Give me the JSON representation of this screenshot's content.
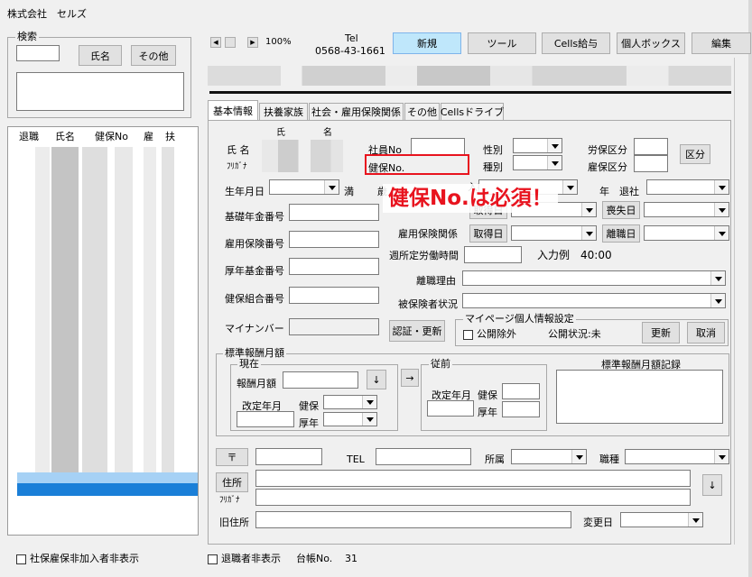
{
  "window": {
    "title": "株式会社　セルズ"
  },
  "search": {
    "group_title": "検索",
    "name_button": "氏名",
    "other_button": "その他",
    "columns": [
      "退職",
      "氏名",
      "健保No",
      "雇",
      "扶"
    ]
  },
  "footer_left": {
    "checkbox_label": "社保雇保非加入者非表示"
  },
  "nav": {
    "zoom": "100%",
    "tel_label": "Tel",
    "tel_number": "0568-43-1661"
  },
  "toolbar": {
    "new": "新規",
    "tool": "ツール",
    "cells_pay": "Cells給与",
    "personal_box": "個人ボックス",
    "edit": "編集"
  },
  "tabs": [
    "基本情報",
    "扶養家族",
    "社会・雇用保険関係",
    "その他",
    "Cellsドライブ"
  ],
  "form": {
    "name_label": "氏 名",
    "kana_label": "ﾌﾘｶﾞﾅ",
    "surname_header": "氏",
    "givenname_header": "名",
    "employee_no_label": "社員No",
    "health_no_label": "健保No.",
    "gender_label": "性別",
    "type_label": "種別",
    "labor_class_label": "労保区分",
    "employment_class_label": "雇保区分",
    "class_button": "区分",
    "birthdate_label": "生年月日",
    "age_label": "満",
    "age_unit": "歳",
    "join_label": "入社",
    "years_label": "年",
    "leave_label": "退社",
    "pension_no_label": "基礎年金番号",
    "acquire_button": "取得日",
    "loss_button": "喪失日",
    "employment_ins_label": "雇用保険関係",
    "leave_date_button": "離職日",
    "emp_ins_no_label": "雇用保険番号",
    "weekly_hours_label": "週所定労働時間",
    "input_example": "入力例　40:00",
    "pension_fund_no_label": "厚年基金番号",
    "leave_reason_label": "離職理由",
    "health_union_no_label": "健保組合番号",
    "insured_status_label": "被保険者状況",
    "mynumber_label": "マイナンバー",
    "auth_update_button": "認証・更新",
    "mypage_group": "マイページ個人情報設定",
    "public_exclude_label": "公開除外",
    "public_status": "公開状況:未",
    "update_button": "更新",
    "cancel_button": "取消"
  },
  "salary": {
    "group": "標準報酬月額",
    "current": "現在",
    "monthly_label": "報酬月額",
    "revised_label": "改定年月",
    "health_label": "健保",
    "pension_label": "厚年",
    "previous": "従前",
    "record_title": "標準報酬月額記録"
  },
  "address": {
    "postal_symbol": "〒",
    "tel_label": "TEL",
    "dept_label": "所属",
    "job_label": "職種",
    "address_button": "住所",
    "kana_label": "ﾌﾘｶﾞﾅ",
    "old_address_label": "旧住所",
    "change_date_label": "変更日"
  },
  "footer": {
    "retired_hide_label": "退職者非表示",
    "ledger_label": "台帳No.",
    "ledger_no": "31"
  },
  "annotation": {
    "text": "健保No.は必須！",
    "color": "#e8131e"
  }
}
